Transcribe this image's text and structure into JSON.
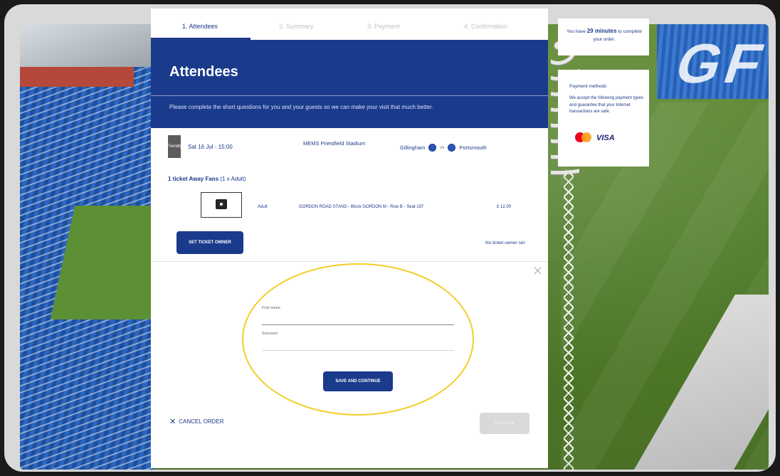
{
  "steps": [
    {
      "label": "1. Attendees",
      "active": true
    },
    {
      "label": "2. Summary",
      "active": false
    },
    {
      "label": "3. Payment",
      "active": false
    },
    {
      "label": "4. Confirmation",
      "active": false
    }
  ],
  "hero": {
    "title": "Attendees",
    "description": "Please complete the short questions for you and your guests so we can make your visit that much better."
  },
  "event": {
    "season": "PRE-SEASON 2022/23",
    "badge": "Friendly",
    "date": "Sat 16 Jul - 15:00",
    "venue": "MEMS Priestfield Stadium",
    "home_team": "Gillingham",
    "vs": "vs",
    "away_team": "Portsmouth"
  },
  "tickets": {
    "heading_bold": "1 ticket Away Fans",
    "heading_rest": " (1 x Adult)",
    "ticket_type": "Adult",
    "seat": "GORDON ROAD STAND - Block GORDON M - Row B - Seat 197",
    "price": "£ 12.00",
    "set_owner_label": "SET TICKET OWNER",
    "no_owner_text": "No ticket owner set"
  },
  "form": {
    "close_glyph": "×",
    "first_name_label": "First name",
    "first_name_value": "",
    "surname_label": "Surname",
    "surname_value": "",
    "save_label": "SAVE AND CONTINUE"
  },
  "footer": {
    "cancel_glyph": "✕",
    "cancel_label": "CANCEL ORDER",
    "continue_label": "CONTINUE"
  },
  "sidebar": {
    "timer_prefix": "You have ",
    "timer_minutes": "29 minutes",
    "timer_suffix": " to complete your order.",
    "payment_title": "Payment methods",
    "payment_desc": "We accept the following payment types and guarantee that your Internet transactions are safe.",
    "visa_label": "VISA"
  },
  "background": {
    "stadium_letters": [
      "G",
      "F"
    ]
  },
  "colors": {
    "primary": "#1a3a8c",
    "highlight": "#f2cd2a",
    "mastercard_red": "#eb001b",
    "mastercard_orange": "#f79e1b",
    "visa_blue": "#1a1f71"
  }
}
